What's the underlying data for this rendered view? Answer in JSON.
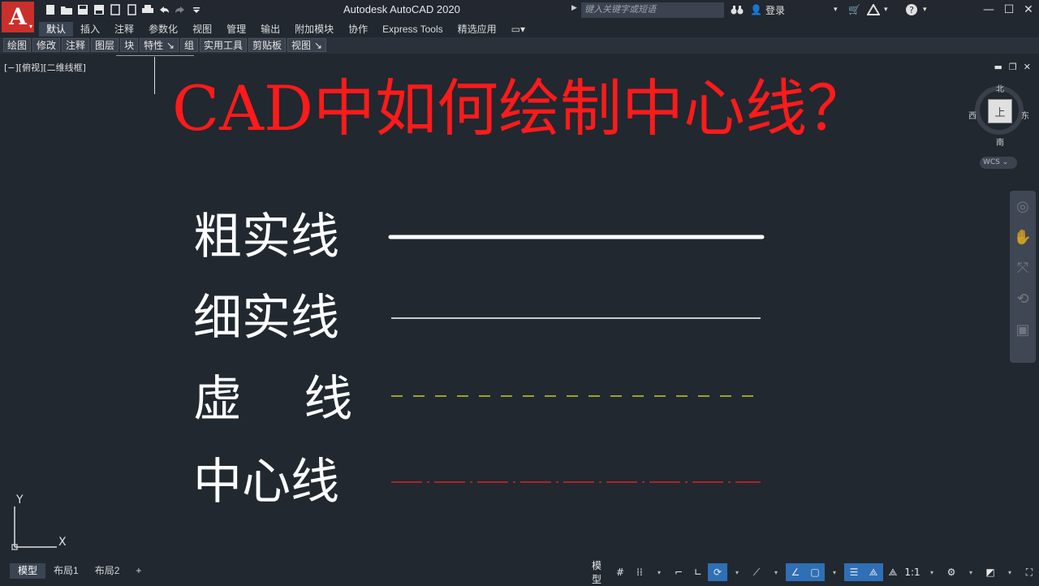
{
  "titlebar": {
    "app_title": "Autodesk AutoCAD 2020",
    "search_placeholder": "键入关键字或短语",
    "login_label": "登录"
  },
  "ribbon_tabs": [
    "默认",
    "插入",
    "注释",
    "参数化",
    "视图",
    "管理",
    "输出",
    "附加模块",
    "协作",
    "Express Tools",
    "精选应用"
  ],
  "active_tab": "默认",
  "panels": [
    "绘图",
    "修改",
    "注释",
    "图层",
    "块",
    "特性 ↘",
    "组",
    "实用工具",
    "剪贴板",
    "视图 ↘"
  ],
  "viewport_label": "[−][俯视][二维线框]",
  "canvas": {
    "title": "CAD中如何绘制中心线？",
    "title_color": "#ff1a1a",
    "linetypes": [
      {
        "label": "粗实线",
        "color": "#ffffff",
        "style": "thick-solid"
      },
      {
        "label": "细实线",
        "color": "#ffffff",
        "style": "thin-solid"
      },
      {
        "label": "虚    线",
        "color": "#c8c82a",
        "style": "dashed"
      },
      {
        "label": "中心线",
        "color": "#e0201e",
        "style": "center"
      }
    ]
  },
  "navcube": {
    "north": "北",
    "south": "南",
    "east": "东",
    "west": "西",
    "face": "上",
    "wcs": "WCS"
  },
  "ucs": {
    "x_label": "X",
    "y_label": "Y"
  },
  "layout_tabs": [
    "模型",
    "布局1",
    "布局2",
    "+"
  ],
  "statusbar": {
    "model_label": "模型",
    "scale_label": "1:1"
  },
  "colors": {
    "background": "#212830",
    "accent": "#2f6fb5",
    "logo": "#c9302c"
  }
}
